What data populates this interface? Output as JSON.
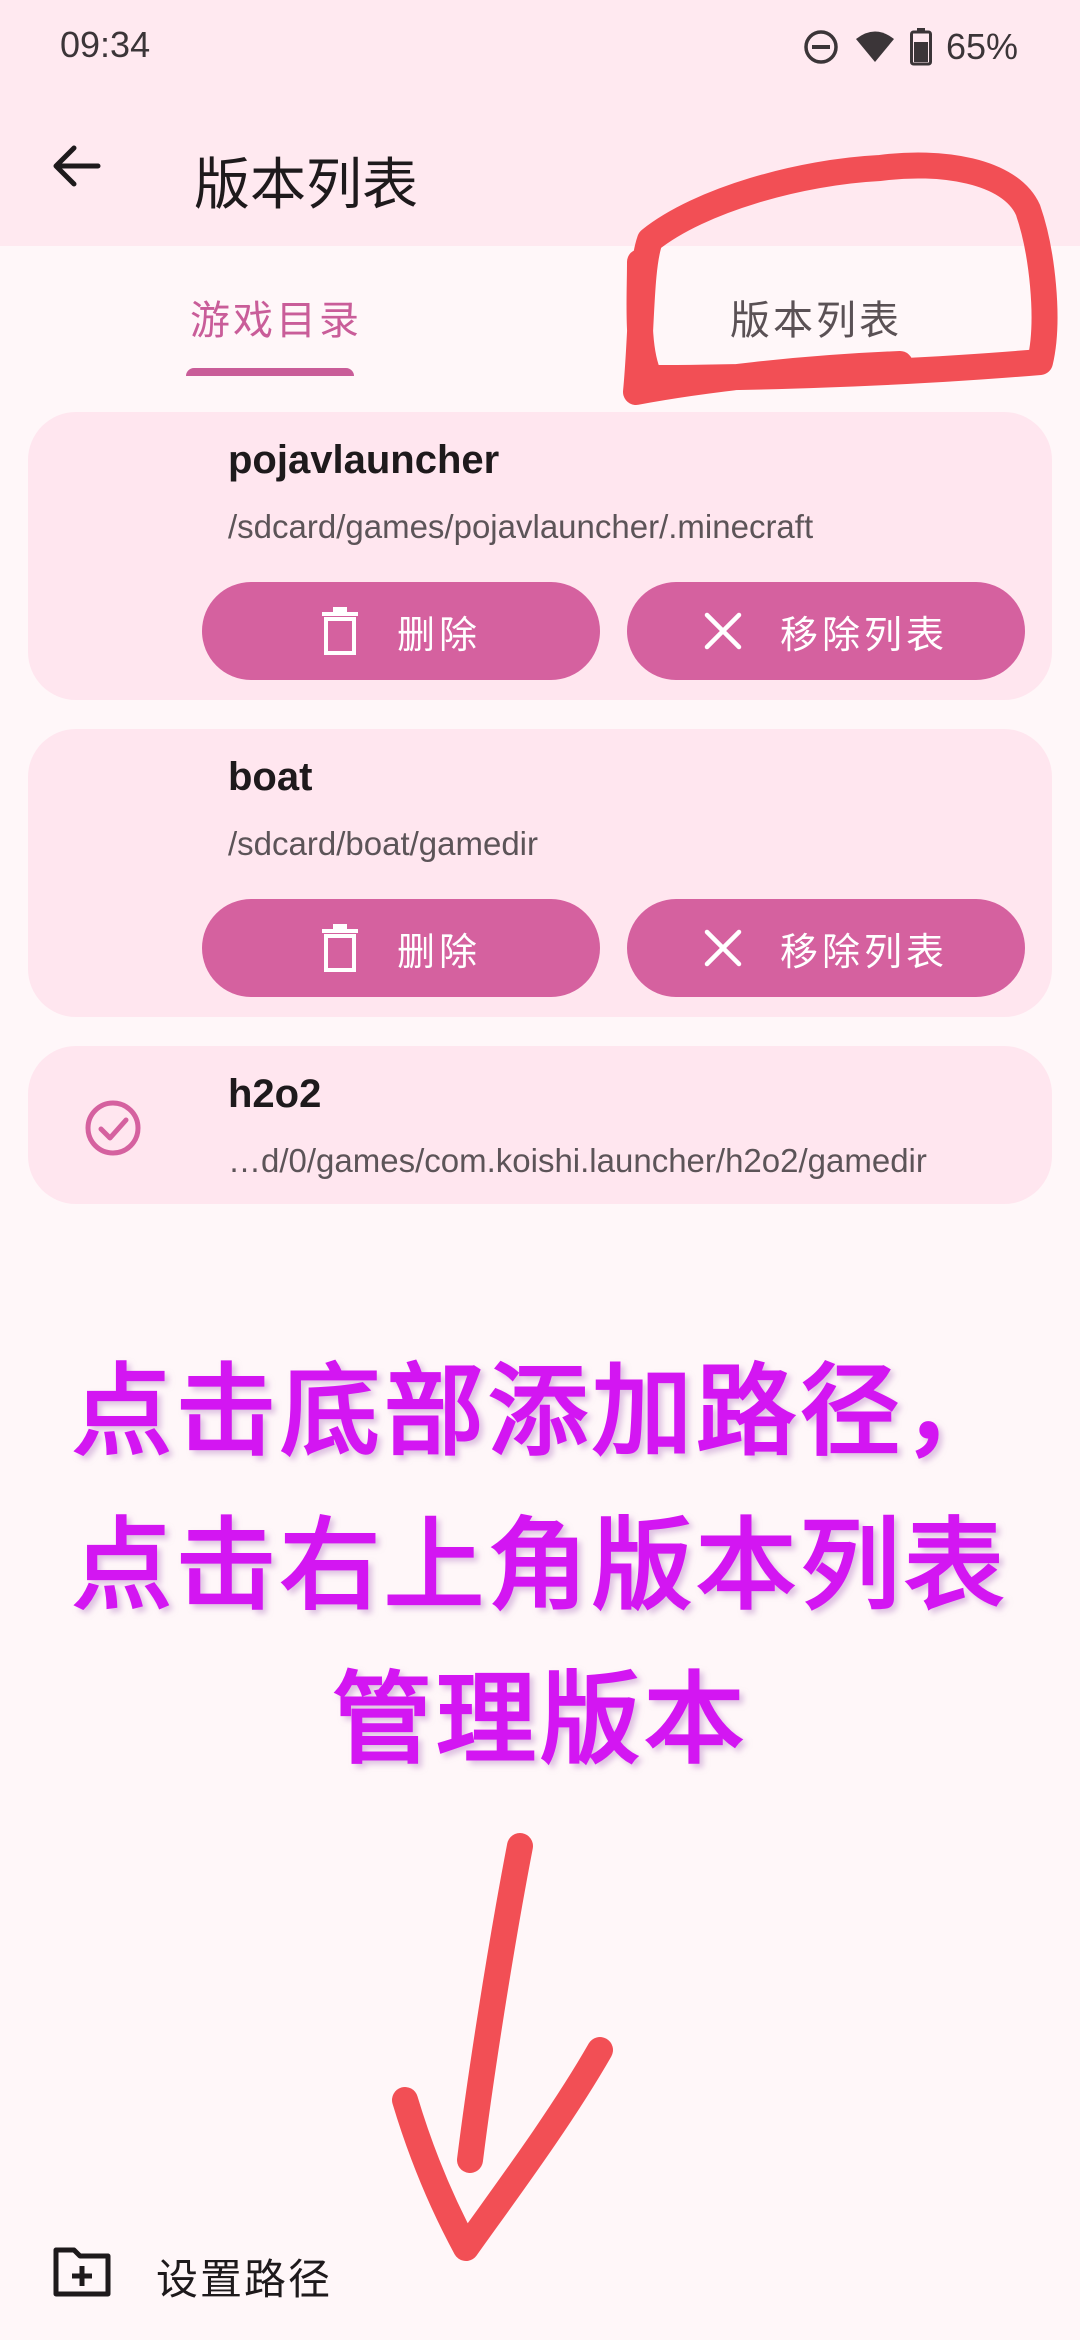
{
  "status_bar": {
    "time": "09:34",
    "battery": "65%",
    "icons": [
      "do-not-disturb-icon",
      "wifi-icon",
      "battery-icon"
    ]
  },
  "app_bar": {
    "title": "版本列表",
    "back_icon": "arrow-back-icon"
  },
  "tabs": [
    {
      "label": "游戏目录",
      "selected": true
    },
    {
      "label": "版本列表",
      "selected": false
    }
  ],
  "directories": [
    {
      "name": "pojavlauncher",
      "path": "/sdcard/games/pojavlauncher/.minecraft",
      "selected": false,
      "delete_label": "删除",
      "remove_label": "移除列表"
    },
    {
      "name": "boat",
      "path": "/sdcard/boat/gamedir",
      "selected": false,
      "delete_label": "删除",
      "remove_label": "移除列表"
    },
    {
      "name": "h2o2",
      "path": "…d/0/games/com.koishi.launcher/h2o2/gamedir",
      "selected": true
    }
  ],
  "annotation": {
    "lines": [
      "点击底部添加路径，",
      "点击右上角版本列表",
      "管理版本"
    ]
  },
  "bottom_action": {
    "label": "设置路径",
    "icon": "folder-add-icon"
  },
  "colors": {
    "accent": "#d5619f",
    "card_bg": "#ffe6ef",
    "annotation_text": "#d316f2",
    "markup_red": "#f24f55"
  }
}
